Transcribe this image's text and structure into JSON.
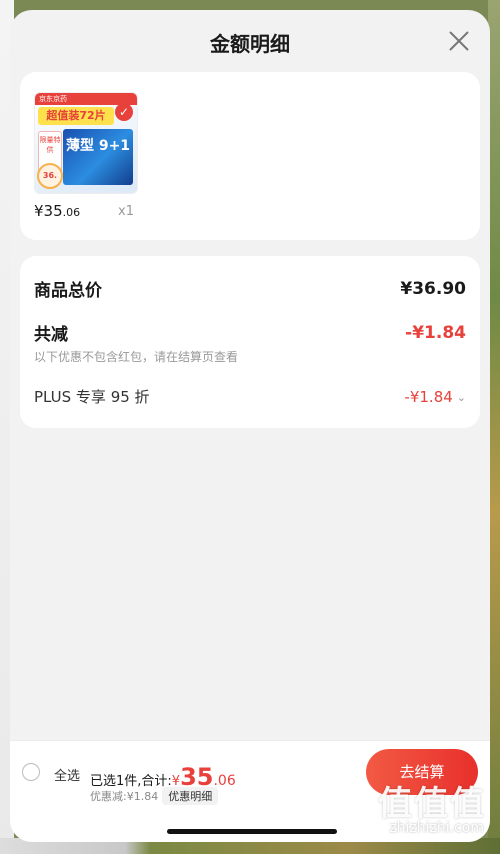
{
  "header": {
    "title": "金额明细"
  },
  "product": {
    "image_banner": "京东京药",
    "image_slogan": "超值装72片",
    "image_box_text": "薄型 9+1",
    "image_tag": "限量特供",
    "image_badge": "36.",
    "price_int": "¥35",
    "price_dec": ".06",
    "qty": "x1"
  },
  "detail": {
    "total_label": "商品总价",
    "total_value": "¥36.90",
    "reduce_label": "共减",
    "reduce_value": "-¥1.84",
    "reduce_note": "以下优惠不包含红包，请在结算页查看",
    "plus_label": "PLUS 专享 95 折",
    "plus_value": "-¥1.84"
  },
  "bottom": {
    "select_all": "全选",
    "selected_text": "已选1件,合计:",
    "sum_yen": "¥",
    "sum_int": "35",
    "sum_dec": ".06",
    "discount_text": "优惠减:¥1.84",
    "discount_detail": "优惠明细",
    "checkout": "去结算"
  },
  "watermark": {
    "logo": "值值值",
    "text": "zhizhizhi.com"
  },
  "colors": {
    "accent": "#e8403a",
    "background": "#f2f2f2",
    "card": "#ffffff"
  }
}
